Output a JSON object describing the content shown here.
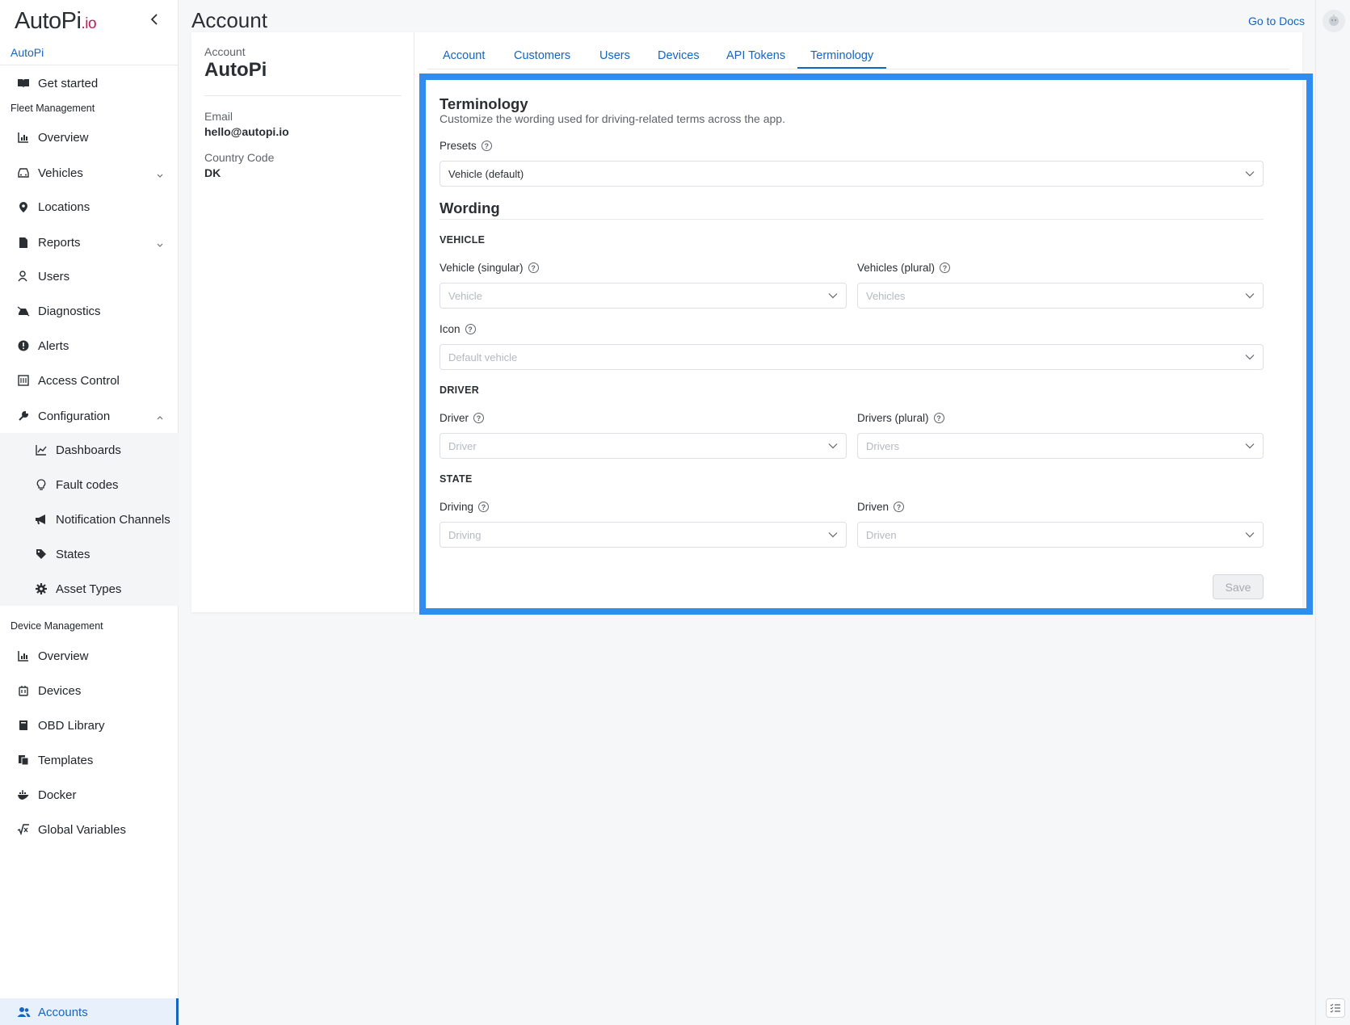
{
  "brand": {
    "logo_main": "AutoPi",
    "logo_suffix": ".io",
    "org_name": "AutoPi"
  },
  "sidebar": {
    "get_started": "Get started",
    "fleet_label": "Fleet Management",
    "fleet_items": [
      {
        "label": "Overview",
        "icon": "chart-icon"
      },
      {
        "label": "Vehicles",
        "icon": "car-icon"
      },
      {
        "label": "Locations",
        "icon": "pin-icon"
      },
      {
        "label": "Reports",
        "icon": "file-icon"
      },
      {
        "label": "Users",
        "icon": "user-icon"
      },
      {
        "label": "Diagnostics",
        "icon": "diagnostics-icon"
      },
      {
        "label": "Alerts",
        "icon": "alert-icon"
      },
      {
        "label": "Access Control",
        "icon": "access-icon"
      },
      {
        "label": "Configuration",
        "icon": "wrench-icon"
      }
    ],
    "config_items": [
      {
        "label": "Dashboards",
        "icon": "line-chart-icon"
      },
      {
        "label": "Fault codes",
        "icon": "bulb-icon"
      },
      {
        "label": "Notification Channels",
        "icon": "megaphone-icon"
      },
      {
        "label": "States",
        "icon": "tag-icon"
      },
      {
        "label": "Asset Types",
        "icon": "gear-icon"
      }
    ],
    "device_label": "Device Management",
    "device_items": [
      {
        "label": "Overview",
        "icon": "chart-icon"
      },
      {
        "label": "Devices",
        "icon": "device-icon"
      },
      {
        "label": "OBD Library",
        "icon": "book-icon"
      },
      {
        "label": "Templates",
        "icon": "templates-icon"
      },
      {
        "label": "Docker",
        "icon": "docker-icon"
      },
      {
        "label": "Global Variables",
        "icon": "sqrt-icon"
      }
    ],
    "accounts": "Accounts"
  },
  "header": {
    "title": "Account",
    "docs_link": "Go to Docs"
  },
  "account_info": {
    "account_label": "Account",
    "account_name": "AutoPi",
    "email_label": "Email",
    "email_value": "hello@autopi.io",
    "country_label": "Country Code",
    "country_value": "DK"
  },
  "tabs": [
    "Account",
    "Customers",
    "Users",
    "Devices",
    "API Tokens",
    "Terminology"
  ],
  "active_tab": "Terminology",
  "form": {
    "title": "Terminology",
    "description": "Customize the wording used for driving-related terms across the app.",
    "presets_label": "Presets",
    "presets_value": "Vehicle (default)",
    "wording_title": "Wording",
    "vehicle_group": "VEHICLE",
    "vehicle_singular_label": "Vehicle (singular)",
    "vehicle_singular_placeholder": "Vehicle",
    "vehicles_plural_label": "Vehicles (plural)",
    "vehicles_plural_placeholder": "Vehicles",
    "icon_label": "Icon",
    "icon_placeholder": "Default vehicle",
    "driver_group": "DRIVER",
    "driver_label": "Driver",
    "driver_placeholder": "Driver",
    "drivers_plural_label": "Drivers (plural)",
    "drivers_plural_placeholder": "Drivers",
    "state_group": "STATE",
    "driving_label": "Driving",
    "driving_placeholder": "Driving",
    "driven_label": "Driven",
    "driven_placeholder": "Driven",
    "save_label": "Save"
  },
  "colors": {
    "accent": "#1565c0",
    "highlight_frame": "#2f8cf1",
    "brand_suffix": "#c2185b"
  }
}
